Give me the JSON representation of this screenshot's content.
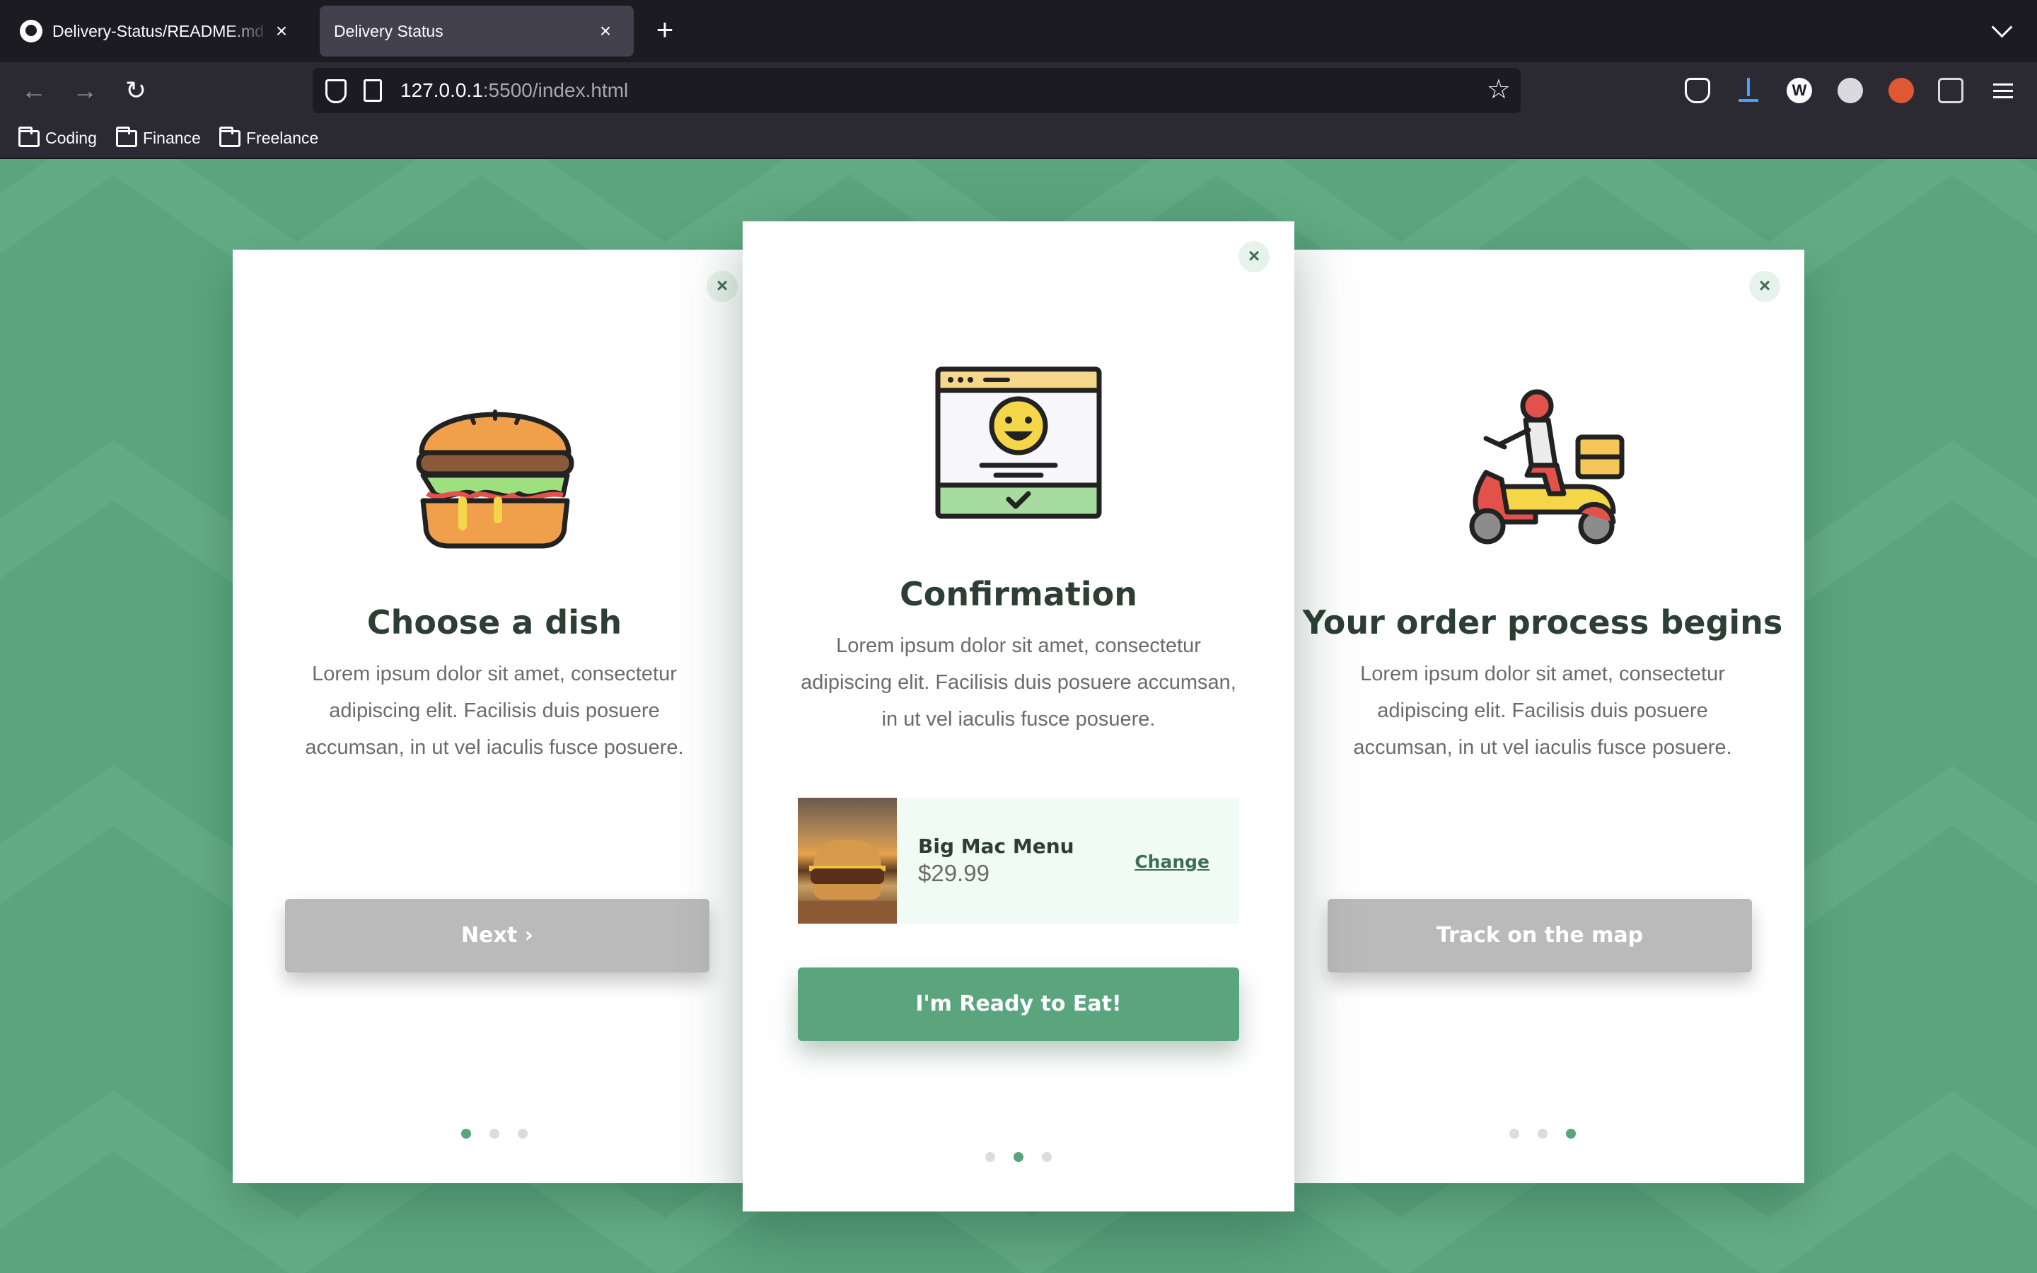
{
  "browser": {
    "tabs": [
      {
        "title": "Delivery-Status/README.md at main",
        "active": false
      },
      {
        "title": "Delivery Status",
        "active": true
      }
    ],
    "url_host": "127.0.0.1",
    "url_rest": ":5500/index.html",
    "bookmarks": [
      "Coding",
      "Finance",
      "Freelance"
    ],
    "icons": [
      "back-icon",
      "forward-icon",
      "reload-icon",
      "shield-icon",
      "page-icon",
      "star-icon",
      "pocket-icon",
      "download-icon",
      "wikipedia-icon",
      "extension-icon",
      "duckduckgo-icon",
      "reader-icon",
      "menu-icon"
    ]
  },
  "colors": {
    "background": "#5aa57e",
    "accent": "#5aa57e",
    "button_disabled": "#bababa",
    "title": "#2c3e36"
  },
  "cards": {
    "left": {
      "title": "Choose a dish",
      "text": "Lorem ipsum dolor sit amet, consectetur adipiscing elit. Facilisis duis posuere accumsan, in ut vel iaculis fusce posuere.",
      "button": "Next ›",
      "icon": "burger-icon",
      "step": 1,
      "steps": 3
    },
    "center": {
      "title": "Confirmation",
      "text": "Lorem ipsum dolor sit amet, consectetur adipiscing elit. Facilisis duis posuere accumsan, in ut vel iaculis fusce posuere.",
      "order_name": "Big Mac Menu",
      "order_price": "$29.99",
      "change_label": "Change",
      "button": "I'm Ready to Eat!",
      "icon": "confirmation-window-icon",
      "step": 2,
      "steps": 3
    },
    "right": {
      "title": "Your order process begins",
      "text": "Lorem ipsum dolor sit amet, consectetur adipiscing elit. Facilisis duis posuere accumsan, in ut vel iaculis fusce posuere.",
      "button": "Track on the map",
      "icon": "delivery-scooter-icon",
      "step": 3,
      "steps": 3
    },
    "close_label": "×"
  }
}
